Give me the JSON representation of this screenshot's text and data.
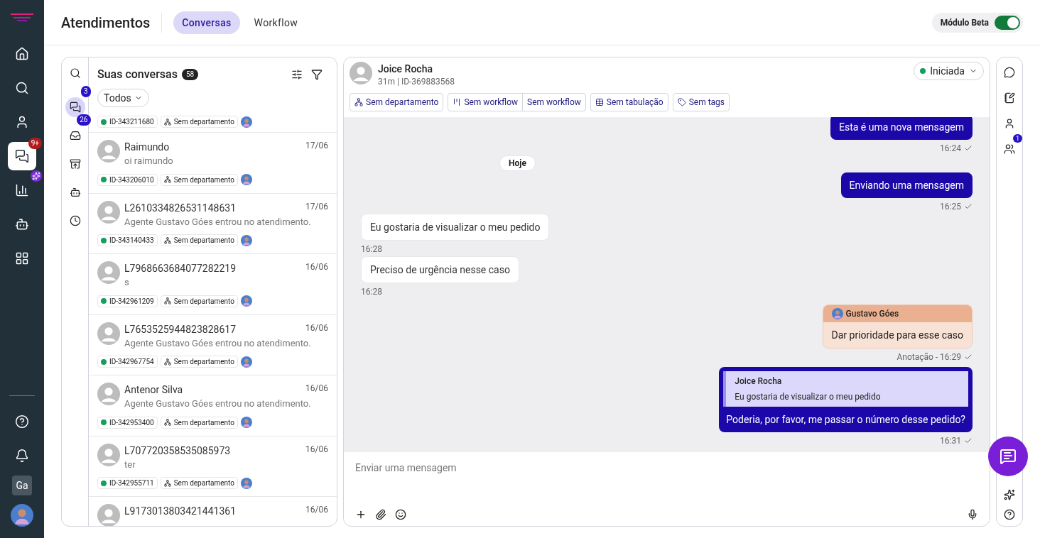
{
  "nav": {
    "items": [
      {
        "selected": false
      },
      {
        "selected": false
      },
      {
        "selected": false
      },
      {
        "selected": true,
        "badge": "9+"
      },
      {
        "selected": false
      },
      {
        "selected": false
      },
      {
        "selected": false
      }
    ],
    "initials": "Ga"
  },
  "header": {
    "title": "Atendimentos",
    "tabs": [
      {
        "label": "Conversas",
        "selected": true
      },
      {
        "label": "Workflow",
        "selected": false
      }
    ],
    "beta": {
      "label": "Módulo Beta",
      "on": true
    }
  },
  "rail": [
    {
      "selected": false
    },
    {
      "selected": true,
      "badge": "3"
    },
    {
      "selected": false,
      "badge": "26"
    },
    {
      "selected": false
    },
    {
      "selected": false
    },
    {
      "selected": false
    }
  ],
  "list": {
    "title": "Suas conversas",
    "count": "58",
    "filter": "Todos",
    "items": [
      {
        "id": "ID-343211680",
        "department": "Sem departamento"
      },
      {
        "name": "Raimundo",
        "date": "17/06",
        "preview": "oi raimundo",
        "id": "ID-343206010",
        "department": "Sem departamento"
      },
      {
        "name": "L2610334826531148631",
        "date": "17/06",
        "preview": "Agente Gustavo Góes entrou no atendimento.",
        "id": "ID-343140433",
        "department": "Sem departamento"
      },
      {
        "name": "L7968663684077282219",
        "date": "16/06",
        "preview": "s",
        "id": "ID-342961209",
        "department": "Sem departamento"
      },
      {
        "name": "L7653525944823828617",
        "date": "16/06",
        "preview": "Agente Gustavo Góes entrou no atendimento.",
        "id": "ID-342967754",
        "department": "Sem departamento"
      },
      {
        "name": "Antenor Silva",
        "date": "16/06",
        "preview": "Agente Gustavo Góes entrou no atendimento.",
        "id": "ID-342953400",
        "department": "Sem departamento"
      },
      {
        "name": "L707720358535085973",
        "date": "16/06",
        "preview": "ter",
        "id": "ID-342955711",
        "department": "Sem departamento"
      },
      {
        "name": "L9173013803421441361",
        "date": "16/06"
      }
    ]
  },
  "chat": {
    "contact": "Joice Rocha",
    "meta": "31m | ID-369883568",
    "status": "Iniciada",
    "chips": [
      {
        "labels": [
          "Sem departamento"
        ]
      },
      {
        "labels": [
          "Sem workflow",
          "Sem workflow"
        ]
      },
      {
        "labels": [
          "Sem tabulação"
        ]
      },
      {
        "labels": [
          "Sem tags"
        ]
      }
    ],
    "messages": [
      {
        "kind": "outgoing",
        "text": "Esta é uma nova mensagem",
        "time": "16:24"
      },
      {
        "kind": "divider",
        "text": "Hoje"
      },
      {
        "kind": "outgoing",
        "text": "Enviando uma mensagem",
        "time": "16:25"
      },
      {
        "kind": "incoming",
        "text": "Eu gostaria de visualizar o meu pedido",
        "time": "16:28"
      },
      {
        "kind": "incoming",
        "text": "Preciso de urgência nesse caso",
        "time": "16:28"
      },
      {
        "kind": "note",
        "author": "Gustavo Góes",
        "text": "Dar prioridade para esse caso",
        "time": "Anotação - 16:29"
      },
      {
        "kind": "reply",
        "quote_author": "Joice Rocha",
        "quote_text": "Eu gostaria de visualizar o meu pedido",
        "text": "Poderia, por favor, me passar o número desse pedido?",
        "time": "16:31"
      }
    ],
    "composer": {
      "placeholder": "Enviar uma mensagem"
    }
  },
  "side_badge": "1"
}
